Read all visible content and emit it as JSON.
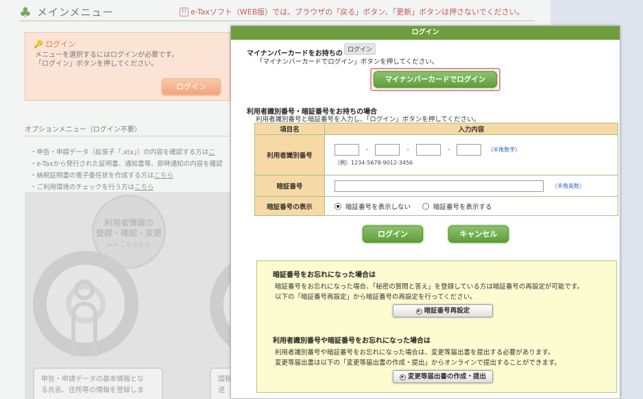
{
  "background": {
    "header_title": "メインメニュー",
    "warning_icon": "!!",
    "warning_text": "e-Taxソフト（WEB版）では、ブラウザの「戻る」ボタン、「更新」ボタンは押さないでください。",
    "login_panel": {
      "title": "ログイン",
      "line1": "メニューを選択するにはログインが必要です。",
      "line2": "「ログイン」ボタンを押してください。",
      "button": "ログイン"
    },
    "options": {
      "title": "オプションメニュー（ログイン不要）",
      "items": [
        {
          "text": "・申告・申請データ（拡張子「.xtx」）の内容を確認する方は",
          "link": "こ"
        },
        {
          "text": "・e-Taxから発行された証明書、通知書等、即時通知の内容を確認",
          "link": ""
        },
        {
          "text": "・納税証明書の電子委任状を作成する方は",
          "link": "こちら"
        },
        {
          "text": "・ご利用環境のチェックを行う方は",
          "link": "こちら"
        }
      ]
    },
    "user_info": {
      "line1": "利用者情報の",
      "line2": "登録・確認・変更",
      "sub": ">> こちらから"
    },
    "card_text1": {
      "line1": "申告・申請データの基本情報とな",
      "line2": "る氏名、住所等の情報を登録しま"
    },
    "card_text2": {
      "line1": "国税",
      "line2": "送"
    }
  },
  "modal": {
    "title": "ログイン",
    "tooltip": "ログイン",
    "mynumber": {
      "heading": "マイナンバーカードをお持ちの",
      "instruction": "「マイナンバーカードでログイン」ボタンを押してください。",
      "button": "マイナンバーカードでログイン"
    },
    "id_section": {
      "heading": "利用者識別番号・暗証番号をお持ちの場合",
      "instruction": "利用者識別番号と暗証番号を入力し、「ログイン」ボタンを押してください。"
    },
    "table": {
      "col_item": "項目名",
      "col_input": "入力内容",
      "id_label": "利用者識別番号",
      "id_hint": "（半角数字）",
      "id_example": "（例）1234-5678-9012-3456",
      "dash": "-",
      "pw_label": "暗証番号",
      "pw_hint": "（半角英数）",
      "show_label": "暗証番号の表示",
      "opt_hide": "暗証番号を表示しない",
      "opt_show": "暗証番号を表示する",
      "selected": "hide"
    },
    "login_button": "ログイン",
    "cancel_button": "キャンセル",
    "forgot": {
      "h1": "暗証番号をお忘れになった場合は",
      "t1a": "暗証番号をお忘れになった場合、「秘密の質問と答え」を登録している方は暗証番号の再設定が可能です。",
      "t1b": "以下の「暗証番号再設定」から暗証番号の再設定を行ってください。",
      "btn1": "暗証番号再設定",
      "h2": "利用者識別番号や暗証番号をお忘れになった場合は",
      "t2a": "利用者識別番号や暗証番号をお忘れになった場合は、変更等届出書を提出する必要があります。",
      "t2b": "変更等届出書は以下の「変更等届出書の作成・提出」からオンラインで提出することができます。",
      "btn2": "変更等届出書の作成・提出"
    }
  },
  "colors": {
    "accent_green": "#6e9e3f",
    "table_header": "#f7d9a5",
    "warning_red": "#c45a5a",
    "focus_pink": "#e48b98"
  }
}
